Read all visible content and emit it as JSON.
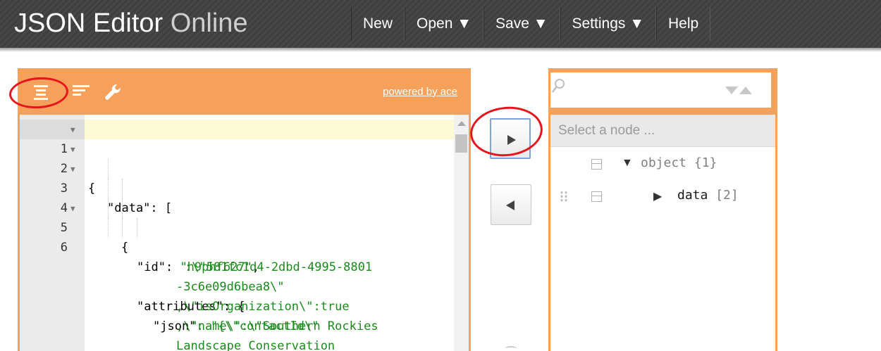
{
  "app": {
    "title_bold": "JSON Editor",
    "title_light": "Online"
  },
  "menu": [
    {
      "label": "New"
    },
    {
      "label": "Open ▼"
    },
    {
      "label": "Save ▼"
    },
    {
      "label": "Settings ▼"
    },
    {
      "label": "Help"
    }
  ],
  "code_panel": {
    "powered_by": "powered by ace",
    "lines": [
      {
        "num": "1",
        "fold": "▼"
      },
      {
        "num": "2",
        "fold": "▼"
      },
      {
        "num": "3",
        "fold": "▼"
      },
      {
        "num": "4",
        "fold": ""
      },
      {
        "num": "5",
        "fold": "▼"
      },
      {
        "num": "6",
        "fold": ""
      }
    ],
    "text": {
      "l1": "{",
      "l2_key": "\"data\"",
      "l2_rest": ": [",
      "l3": "{",
      "l4_key": "\"id\"",
      "l4_sep": ": ",
      "l4_val": "\"h9phf627\"",
      "l4_end": ",",
      "l5_key": "\"attributes\"",
      "l5_rest": ": {",
      "l6_key": "\"json\"",
      "l6_sep": ": ",
      "l6_val": "\"{\\\"contactId\\\"",
      "w1": ":\\\"581fc1d4-2dbd-4995-8801",
      "w2": "-3c6e09d6bea8\\\"",
      "w3": ",\\\"isOrganization\\\":true",
      "w4": ",\\\"name\\\":\\\"Southern Rockies",
      "w5": "Landscape Conservation"
    }
  },
  "tree_panel": {
    "search_placeholder": "",
    "nav_placeholder": "Select a node ...",
    "nodes": [
      {
        "key": "object",
        "count": "{1}",
        "expand": "▼"
      },
      {
        "key": "data",
        "count": "[2]",
        "expand": "▶"
      }
    ]
  },
  "colors": {
    "accent": "#f5a15b",
    "annotation": "#e8131b",
    "string": "#1a8a1a"
  },
  "icons": {
    "code_format": "format-indent-icon",
    "code_compact": "compact-icon",
    "code_repair": "wrench-icon",
    "search": "search-icon",
    "copy_to_tree": "arrow-right-icon",
    "copy_to_code": "arrow-left-icon"
  }
}
